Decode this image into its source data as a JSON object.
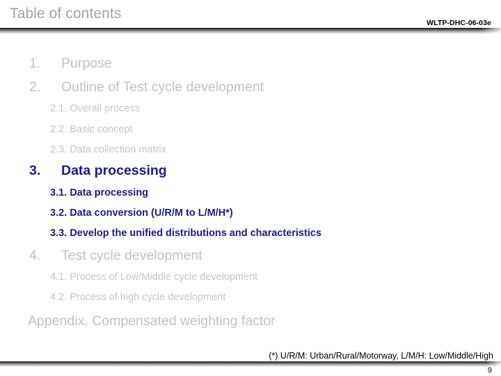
{
  "header": {
    "title": "Table of contents",
    "doc_code": "WLTP-DHC-06-03e"
  },
  "colors": {
    "dim_text": "#c2c2c2",
    "title_gray": "#a3a3a3",
    "highlight_navy": "#1b1b8f",
    "footnote_black": "#000000",
    "background": "#ffffff"
  },
  "toc": {
    "entries": [
      {
        "number": "1.",
        "label": "Purpose",
        "state": "dim"
      },
      {
        "number": "2.",
        "label": "Outline of Test cycle development",
        "state": "dim"
      },
      {
        "label": "2.1. Overall process",
        "state": "dim"
      },
      {
        "label": "2.2. Basic concept",
        "state": "dim"
      },
      {
        "label": "2.3. Data collection matrix",
        "state": "dim"
      },
      {
        "number": "3.",
        "label": "Data processing",
        "state": "highlight"
      },
      {
        "label": "3.1. Data processing",
        "state": "highlight"
      },
      {
        "label": "3.2. Data conversion (U/R/M to L/M/H*)",
        "state": "highlight"
      },
      {
        "label": "3.3. Develop the unified distributions and characteristics",
        "state": "highlight"
      },
      {
        "number": "4.",
        "label": "Test cycle development",
        "state": "dim"
      },
      {
        "label": "4.1. Process of Low/Middle cycle development",
        "state": "dim"
      },
      {
        "label": "4.2. Process of high cycle development",
        "state": "dim"
      },
      {
        "label": "Appendix.  Compensated weighting factor",
        "state": "dim"
      }
    ]
  },
  "footer": {
    "footnote": "(*) U/R/M: Urban/Rural/Motorway, L/M/H: Low/Middle/High",
    "page_number": "9"
  }
}
